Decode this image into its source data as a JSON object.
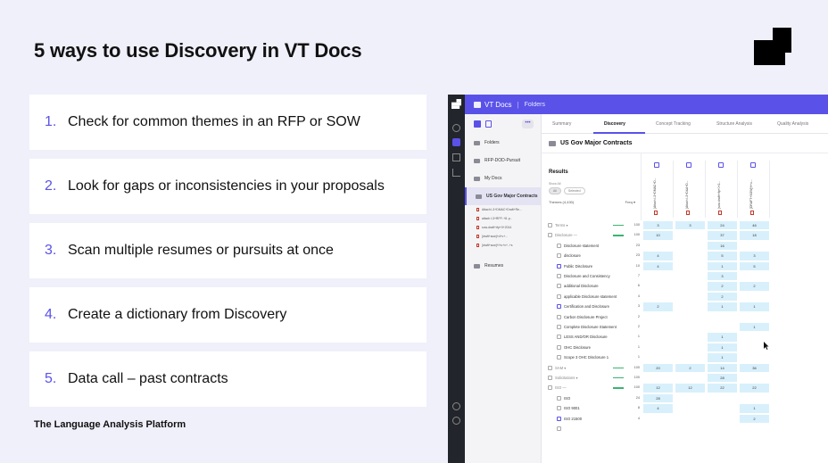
{
  "slide": {
    "title": "5 ways to use Discovery in VT Docs",
    "footer": "The Language Analysis Platform",
    "items": [
      {
        "num": "1.",
        "text": "Check for common themes in an RFP or SOW"
      },
      {
        "num": "2.",
        "text": "Look for gaps or inconsistencies in your proposals"
      },
      {
        "num": "3.",
        "text": "Scan multiple resumes or pursuits at once"
      },
      {
        "num": "4.",
        "text": "Create a dictionary from Discovery"
      },
      {
        "num": "5.",
        "text": "Data call – past contracts"
      }
    ]
  },
  "colors": {
    "accent": "#5a52e8",
    "cell": "#d8f0fb",
    "bar": "#3cb371"
  },
  "app": {
    "brand": "VT Docs",
    "section": "Folders",
    "more": "•••",
    "sidebar": {
      "items": [
        {
          "label": "Folders",
          "active": false
        },
        {
          "label": "RFP-DOD-Pursuit",
          "active": false
        },
        {
          "label": "My Docs",
          "active": false
        },
        {
          "label": "US Gov Major Contracts",
          "active": true
        }
      ],
      "files": [
        "Attach l-3+DMAC+Draft+Re...",
        "attach l-3+RFP..+8..p..",
        "sow-draft+rfp+0+2014",
        "[draft+sow]+d+v+...",
        "[draft+sow]+l+u+v+..+s"
      ],
      "resumes": "Resumes"
    },
    "tabs": [
      "Summary",
      "Discovery",
      "Concept Tracking",
      "Structure Analysis",
      "Quality Analysis"
    ],
    "active_tab": "Discovery",
    "crumb": "US Gov Major Contracts",
    "results": {
      "title": "Results",
      "show_all": "Show All",
      "pill_all": "All",
      "pill_selected": "Selected",
      "col_themes": "Themes (4,430)",
      "col_freq": "Freq ▾"
    },
    "documents": [
      "[Attach l-3+DMAC+D...",
      "[Attach l-3+D&A+D...",
      "[sow draft+rfp+0+2...",
      "[DRAFT+SOW]+l+u..."
    ],
    "rows": [
      {
        "label": "Terms ▾",
        "indent": 0,
        "bar": true,
        "count": "100",
        "cells": [
          "3",
          "3",
          "24",
          "46"
        ],
        "checked": false,
        "muted": true
      },
      {
        "label": "Disclosure ―",
        "indent": 0,
        "bar": true,
        "count": "100",
        "cells": [
          "10",
          "",
          "37",
          "18"
        ],
        "checked": false,
        "muted": true
      },
      {
        "label": "Disclosure statement",
        "indent": 1,
        "bar": false,
        "count": "23",
        "cells": [
          "",
          "",
          "16",
          ""
        ],
        "checked": false,
        "muted": false
      },
      {
        "label": "disclosure",
        "indent": 1,
        "bar": false,
        "count": "23",
        "cells": [
          "4",
          "",
          "5",
          "3"
        ],
        "checked": false,
        "muted": false
      },
      {
        "label": "Public Disclosure",
        "indent": 1,
        "bar": false,
        "count": "10",
        "cells": [
          "4",
          "",
          "1",
          "5"
        ],
        "checked": true,
        "muted": false
      },
      {
        "label": "Disclosure and Consistency",
        "indent": 1,
        "bar": false,
        "count": "7",
        "cells": [
          "",
          "",
          "3",
          ""
        ],
        "checked": false,
        "muted": false
      },
      {
        "label": "additional Disclosure",
        "indent": 1,
        "bar": false,
        "count": "6",
        "cells": [
          "",
          "",
          "2",
          "2"
        ],
        "checked": false,
        "muted": false
      },
      {
        "label": "applicable Disclosure statement",
        "indent": 1,
        "bar": false,
        "count": "4",
        "cells": [
          "",
          "",
          "2",
          ""
        ],
        "checked": false,
        "muted": false
      },
      {
        "label": "Certification and Disclosure",
        "indent": 1,
        "bar": false,
        "count": "3",
        "cells": [
          "2",
          "",
          "1",
          "1"
        ],
        "checked": true,
        "muted": false
      },
      {
        "label": "Carbon Disclosure Project",
        "indent": 1,
        "bar": false,
        "count": "2",
        "cells": [
          "",
          "",
          "",
          ""
        ],
        "checked": false,
        "muted": false
      },
      {
        "label": "Complete Disclosure Statement",
        "indent": 1,
        "bar": false,
        "count": "2",
        "cells": [
          "",
          "",
          "",
          "1"
        ],
        "checked": false,
        "muted": false
      },
      {
        "label": "LESS AND/OR Disclosure",
        "indent": 1,
        "bar": false,
        "count": "1",
        "cells": [
          "",
          "",
          "1",
          ""
        ],
        "checked": false,
        "muted": false
      },
      {
        "label": "OHC Disclosure",
        "indent": 1,
        "bar": false,
        "count": "1",
        "cells": [
          "",
          "",
          "1",
          ""
        ],
        "checked": false,
        "muted": false
      },
      {
        "label": "Scope 3 OHC Disclosure 1",
        "indent": 1,
        "bar": false,
        "count": "1",
        "cells": [
          "",
          "",
          "1",
          ""
        ],
        "checked": false,
        "muted": false
      },
      {
        "label": "SAM ▾",
        "indent": 0,
        "bar": true,
        "count": "100",
        "cells": [
          "20",
          "2",
          "14",
          "36"
        ],
        "checked": false,
        "muted": true
      },
      {
        "label": "Solicitations ▾",
        "indent": 0,
        "bar": true,
        "count": "100",
        "cells": [
          "",
          "",
          "28",
          ""
        ],
        "checked": false,
        "muted": true
      },
      {
        "label": "ISO ―",
        "indent": 0,
        "bar": true,
        "count": "100",
        "cells": [
          "12",
          "12",
          "22",
          "22"
        ],
        "checked": false,
        "muted": true
      },
      {
        "label": "ISO",
        "indent": 1,
        "bar": false,
        "count": "24",
        "cells": [
          "28",
          "",
          "",
          ""
        ],
        "checked": false,
        "muted": false
      },
      {
        "label": "ISO 9001",
        "indent": 1,
        "bar": false,
        "count": "8",
        "cells": [
          "4",
          "",
          "",
          "1"
        ],
        "checked": false,
        "muted": false
      },
      {
        "label": "ISO 21500",
        "indent": 1,
        "bar": false,
        "count": "4",
        "cells": [
          "",
          "",
          "",
          "2"
        ],
        "checked": true,
        "muted": false
      },
      {
        "label": "",
        "indent": 1,
        "bar": false,
        "count": "",
        "cells": [
          "",
          "",
          "",
          ""
        ],
        "checked": false,
        "muted": false
      }
    ]
  }
}
